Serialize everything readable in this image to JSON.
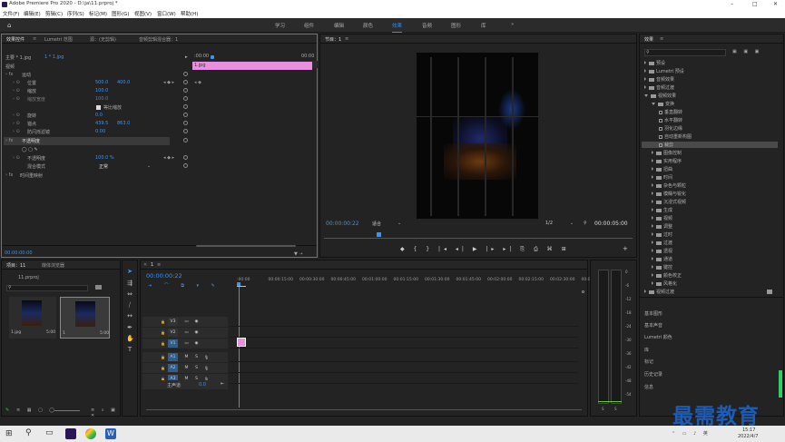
{
  "window": {
    "title": "Adobe Premiere Pro 2020 - D:\\ja\\11.prproj *",
    "controls": [
      "–",
      "□",
      "✕"
    ]
  },
  "menu": [
    "文件(F)",
    "编辑(E)",
    "剪辑(C)",
    "序列(S)",
    "标记(M)",
    "图形(G)",
    "视图(V)",
    "窗口(W)",
    "帮助(H)"
  ],
  "workspaces": [
    "学习",
    "组件",
    "编辑",
    "颜色",
    "效果",
    "音频",
    "图形",
    "库"
  ],
  "workspace_active": "效果",
  "workspace_more": "»",
  "effect_controls": {
    "tabs": [
      "效果控件",
      "Lumetri 范围",
      "源：(无剪辑)",
      "音频剪辑混合器：1"
    ],
    "menu_icon": "≡",
    "source_label": "主要 * 1.jpg",
    "seq_label": "1 * 1.jpg",
    "section_video": "视频",
    "timecode_start": ":00:00",
    "timecode_end": "00:00",
    "clip_name": "1.jpg",
    "fx_motion": "运动",
    "props": [
      {
        "name": "位置",
        "v1": "500.0",
        "v2": "400.0"
      },
      {
        "name": "缩放",
        "v1": "100.0",
        "v2": ""
      },
      {
        "name": "缩放宽度",
        "v1": "100.0",
        "v2": ""
      },
      {
        "name": "等比缩放",
        "v1": "",
        "v2": ""
      },
      {
        "name": "旋转",
        "v1": "0.0",
        "v2": ""
      },
      {
        "name": "锚点",
        "v1": "439.5",
        "v2": "863.0"
      },
      {
        "name": "防闪烁滤镜",
        "v1": "0.00",
        "v2": ""
      }
    ],
    "fx_opacity": "不透明度",
    "opacity_label": "不透明度",
    "opacity_value": "100.0 %",
    "blend_label": "混合模式",
    "blend_value": "正常",
    "time_remap": "时间重映射",
    "bottom_timecode": "00:00:00:00"
  },
  "program": {
    "title": "节目：1",
    "menu_icon": "≡",
    "timecode": "00:00:00:22",
    "fit": "适合",
    "resolution": "1/2",
    "duration": "00:00:05:00"
  },
  "effects": {
    "title": "效果",
    "menu_icon": "≡",
    "items": [
      {
        "label": "预设",
        "indent": 0,
        "open": false
      },
      {
        "label": "Lumetri 预设",
        "indent": 0,
        "open": false
      },
      {
        "label": "音频效果",
        "indent": 0,
        "open": false
      },
      {
        "label": "音频过渡",
        "indent": 0,
        "open": false
      },
      {
        "label": "视频效果",
        "indent": 0,
        "open": true
      },
      {
        "label": "变换",
        "indent": 1,
        "open": true
      },
      {
        "label": "垂直翻转",
        "indent": 2,
        "open": false,
        "leaf": true
      },
      {
        "label": "水平翻转",
        "indent": 2,
        "open": false,
        "leaf": true
      },
      {
        "label": "羽化边缘",
        "indent": 2,
        "open": false,
        "leaf": true
      },
      {
        "label": "自动重新构图",
        "indent": 2,
        "open": false,
        "leaf": true
      },
      {
        "label": "裁剪",
        "indent": 2,
        "open": false,
        "leaf": true,
        "selected": true
      },
      {
        "label": "图像控制",
        "indent": 1,
        "open": false
      },
      {
        "label": "实用程序",
        "indent": 1,
        "open": false
      },
      {
        "label": "扭曲",
        "indent": 1,
        "open": false
      },
      {
        "label": "时间",
        "indent": 1,
        "open": false
      },
      {
        "label": "杂色与颗粒",
        "indent": 1,
        "open": false
      },
      {
        "label": "模糊与锐化",
        "indent": 1,
        "open": false
      },
      {
        "label": "沉浸式视频",
        "indent": 1,
        "open": false
      },
      {
        "label": "生成",
        "indent": 1,
        "open": false
      },
      {
        "label": "视频",
        "indent": 1,
        "open": false
      },
      {
        "label": "调整",
        "indent": 1,
        "open": false
      },
      {
        "label": "过时",
        "indent": 1,
        "open": false
      },
      {
        "label": "过渡",
        "indent": 1,
        "open": false
      },
      {
        "label": "透视",
        "indent": 1,
        "open": false
      },
      {
        "label": "通道",
        "indent": 1,
        "open": false
      },
      {
        "label": "键控",
        "indent": 1,
        "open": false
      },
      {
        "label": "颜色校正",
        "indent": 1,
        "open": false
      },
      {
        "label": "风格化",
        "indent": 1,
        "open": false
      },
      {
        "label": "视频过渡",
        "indent": 0,
        "open": false
      }
    ],
    "panels": [
      "基本图形",
      "基本声音",
      "Lumetri 颜色",
      "库",
      "标记",
      "历史记录",
      "信息"
    ]
  },
  "project": {
    "tabs": [
      "项目：11",
      "媒体浏览器"
    ],
    "file": "11.prproj",
    "clips": [
      {
        "name": "1.jpg",
        "duration": "5:00"
      },
      {
        "name": "1",
        "duration": "5:00"
      }
    ]
  },
  "timeline": {
    "title": "1",
    "menu_icon": "≡",
    "timecode": "00:00:00:22",
    "ruler": [
      ":00:00",
      "00:00:15:00",
      "00:00:30:00",
      "00:00:45:00",
      "00:01:00:00",
      "00:01:15:00",
      "00:01:30:00",
      "00:01:45:00",
      "00:02:00:00",
      "00:02:15:00",
      "00:02:30:00",
      "00:02:45:"
    ],
    "video_tracks": [
      "V3",
      "V2",
      "V1"
    ],
    "audio_tracks": [
      "A1",
      "A2",
      "A3"
    ],
    "master": "主声道",
    "master_value": "0.0"
  },
  "meter": {
    "labels": [
      "0",
      "-6",
      "-12",
      "-18",
      "-24",
      "-30",
      "-36",
      "-42",
      "-48",
      "-54"
    ],
    "bottom": [
      "S",
      "S"
    ]
  },
  "taskbar": {
    "time": "15:17",
    "date": "2022/4/7"
  },
  "watermark": "最需教育",
  "colors": {
    "accent": "#2d8ceb",
    "clip_pink": "#e88fe0",
    "panel_bg": "#232323"
  }
}
